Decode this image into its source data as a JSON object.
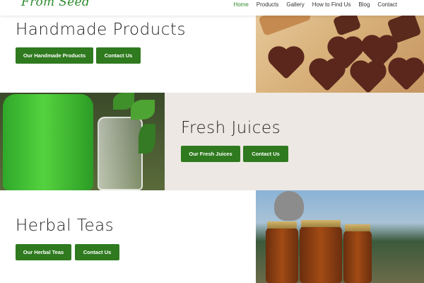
{
  "header": {
    "logo_text": "From Seed",
    "nav": [
      "Home",
      "Products",
      "Gallery",
      "How to Find Us",
      "Blog",
      "Contact"
    ],
    "active": "Home"
  },
  "sections": [
    {
      "heading": "Handmade Products",
      "buttons": [
        "Our Handmade Products",
        "Contact Us"
      ],
      "image": "chocolate-hearts"
    },
    {
      "heading": "Fresh Juices",
      "buttons": [
        "Our Fresh Juices",
        "Contact Us"
      ],
      "image": "green-juice-jars"
    },
    {
      "heading": "Herbal Teas",
      "buttons": [
        "Our Herbal Teas",
        "Contact Us"
      ],
      "image": "herbal-tea-jars"
    }
  ],
  "colors": {
    "brand_green": "#2f7a1f",
    "active_nav": "#2e8b2e",
    "juice_band": "#ede8e3"
  }
}
